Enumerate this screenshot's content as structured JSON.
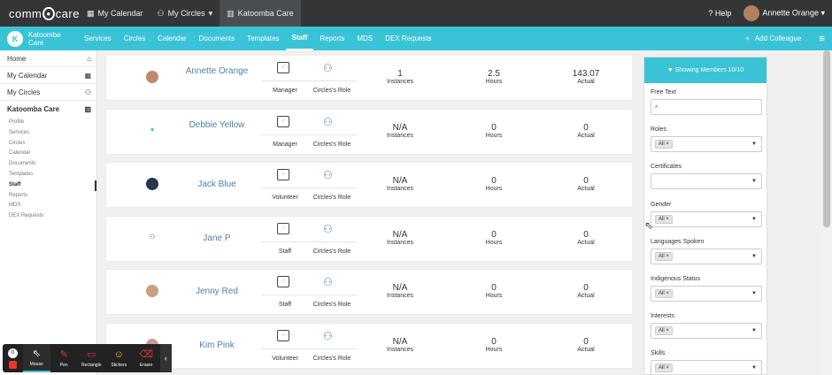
{
  "topbar": {
    "logo_left": "comm",
    "logo_right": "care",
    "nav": [
      {
        "label": "My Calendar",
        "icon": "calendar-icon"
      },
      {
        "label": "My Circles",
        "icon": "people-icon",
        "caret": "▾"
      },
      {
        "label": "Katoomba Care",
        "icon": "building-icon"
      }
    ],
    "help": "Help",
    "user": "Annette Orange",
    "user_caret": "▾"
  },
  "navbar": {
    "brand": "Katoomba Care",
    "items": [
      "Services",
      "Circles",
      "Calendar",
      "Documents",
      "Templates",
      "Staff",
      "Reports",
      "MDS",
      "DEX Requests"
    ],
    "active": "Staff",
    "add": "Add Colleague"
  },
  "sidebar": {
    "top": [
      {
        "label": "Home",
        "icon": "⌂"
      },
      {
        "label": "My Calendar",
        "icon": "▦"
      },
      {
        "label": "My Circles",
        "icon": "⚇"
      }
    ],
    "org": "Katoomba Care",
    "sub": [
      "Profile",
      "Services",
      "Circles",
      "Calendar",
      "Documents",
      "Templates",
      "Staff",
      "Reports",
      "MDS",
      "DEX Requests"
    ],
    "active_sub": "Staff"
  },
  "members": [
    {
      "name": "Annette Orange",
      "role": "Manager",
      "circles": "Circles's Role",
      "instances": "1",
      "instances_lbl": "Instances",
      "hours": "2.5",
      "hours_lbl": "Hours",
      "actual": "143.07",
      "actual_lbl": "Actual",
      "pic": "photo"
    },
    {
      "name": "Debbie Yellow",
      "role": "Manager",
      "circles": "Circles's Role",
      "instances": "N/A",
      "instances_lbl": "Instances",
      "hours": "0",
      "hours_lbl": "Hours",
      "actual": "0",
      "actual_lbl": "Actual",
      "pic": "pattern"
    },
    {
      "name": "Jack Blue",
      "role": "Volunteer",
      "circles": "Circles's Role",
      "instances": "N/A",
      "instances_lbl": "Instances",
      "hours": "0",
      "hours_lbl": "Hours",
      "actual": "0",
      "actual_lbl": "Actual",
      "pic": "photo"
    },
    {
      "name": "Jane P",
      "role": "Staff",
      "circles": "Circles's Role",
      "instances": "N/A",
      "instances_lbl": "Instances",
      "hours": "0",
      "hours_lbl": "Hours",
      "actual": "0",
      "actual_lbl": "Actual",
      "pic": "group"
    },
    {
      "name": "Jenny Red",
      "role": "Staff",
      "circles": "Circles's Role",
      "instances": "N/A",
      "instances_lbl": "Instances",
      "hours": "0",
      "hours_lbl": "Hours",
      "actual": "0",
      "actual_lbl": "Actual",
      "pic": "photo"
    },
    {
      "name": "Kim Pink",
      "role": "Volunteer",
      "circles": "Circles's Role",
      "instances": "N/A",
      "instances_lbl": "Instances",
      "hours": "0",
      "hours_lbl": "Hours",
      "actual": "0",
      "actual_lbl": "Actual",
      "pic": "photo"
    }
  ],
  "filter": {
    "header": "Showing Members 10/10",
    "sections": [
      {
        "label": "Free Text",
        "type": "search"
      },
      {
        "label": "Roles",
        "chip": "All"
      },
      {
        "label": "Certificates",
        "chip": ""
      },
      {
        "label": "Gender",
        "chip": "All"
      },
      {
        "label": "Languages Spoken",
        "chip": "All"
      },
      {
        "label": "Indigenous Status",
        "chip": "All"
      },
      {
        "label": "Interests",
        "chip": "All"
      },
      {
        "label": "Skills",
        "chip": "All"
      }
    ]
  },
  "toolbar": {
    "tools": [
      {
        "label": "Mouse",
        "icon": "cursor-icon"
      },
      {
        "label": "Pen",
        "icon": "pen-icon"
      },
      {
        "label": "Rectangle",
        "icon": "rectangle-icon"
      },
      {
        "label": "Stickers",
        "icon": "sticker-icon"
      },
      {
        "label": "Eraser",
        "icon": "eraser-icon"
      }
    ],
    "active": "Mouse"
  },
  "colors": {
    "accent": "#3ac3d6",
    "link": "#4d7fae",
    "topbar": "#333537"
  }
}
